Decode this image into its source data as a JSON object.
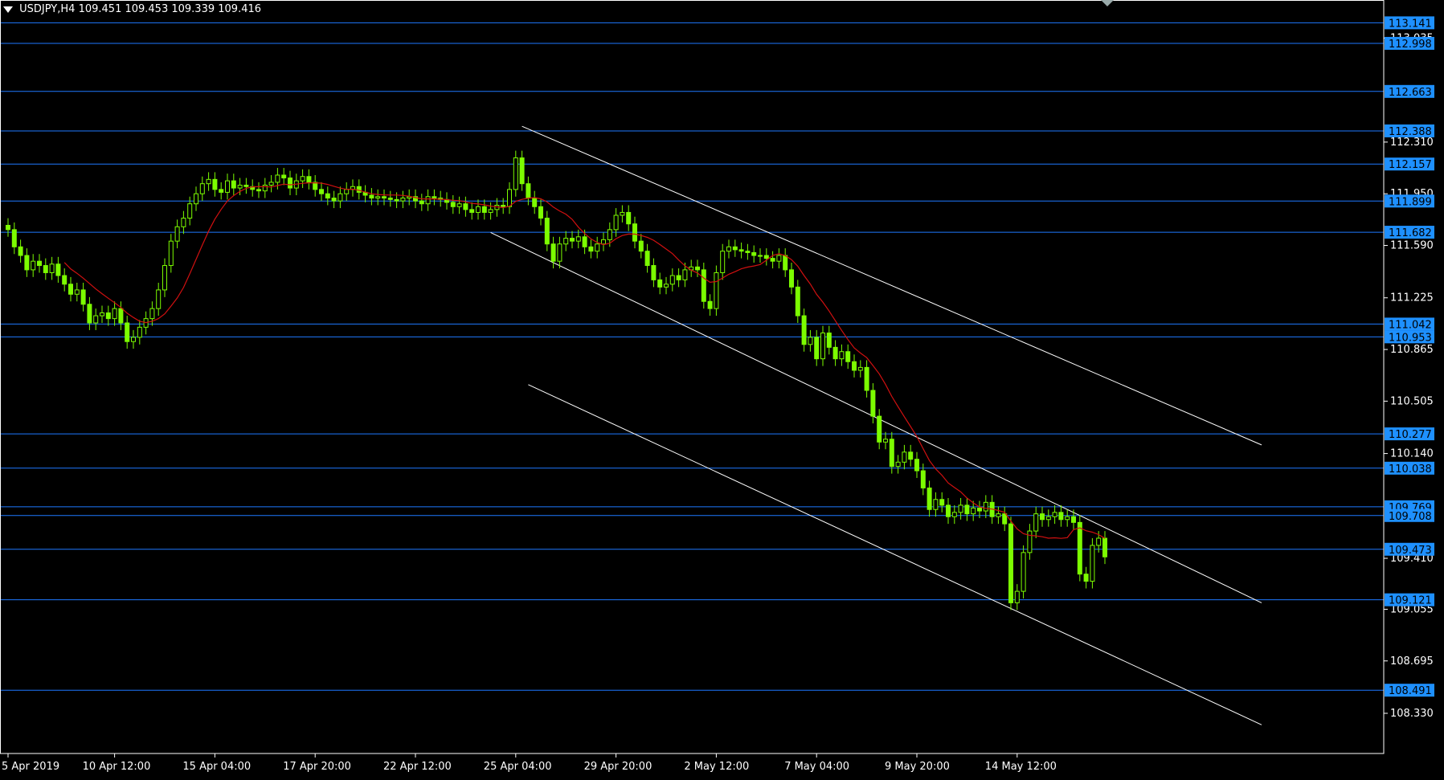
{
  "header": {
    "symbol": "USDJPY,H4",
    "ohlc": "109.451 109.453 109.339 109.416"
  },
  "colors": {
    "background": "#000000",
    "bull_candle": "#7CFC00",
    "level_line": "#1E78FF",
    "channel_line": "#FFFFFF",
    "moving_average": "#D01010",
    "axis_text": "#FFFFFF",
    "highlight_label": "#1E90FF"
  },
  "chart_data": {
    "type": "candlestick",
    "symbol": "USDJPY",
    "timeframe": "H4",
    "ylim": [
      108.05,
      113.3
    ],
    "x_ticks": [
      "5 Apr 2019",
      "10 Apr 12:00",
      "15 Apr 04:00",
      "17 Apr 20:00",
      "22 Apr 12:00",
      "25 Apr 04:00",
      "29 Apr 20:00",
      "2 May 12:00",
      "7 May 04:00",
      "9 May 20:00",
      "14 May 12:00"
    ],
    "y_ticks": [
      "113.035",
      "112.310",
      "111.950",
      "111.590",
      "111.225",
      "110.865",
      "110.505",
      "110.140",
      "109.410",
      "109.055",
      "108.695",
      "108.330"
    ],
    "level_labels": [
      "113.141",
      "112.998",
      "112.663",
      "112.388",
      "112.157",
      "111.899",
      "111.682",
      "111.042",
      "110.953",
      "110.277",
      "110.038",
      "109.769",
      "109.708",
      "109.473",
      "109.121",
      "108.491"
    ],
    "closes": [
      111.7,
      111.58,
      111.52,
      111.42,
      111.48,
      111.45,
      111.4,
      111.46,
      111.38,
      111.32,
      111.25,
      111.28,
      111.18,
      111.05,
      111.1,
      111.12,
      111.08,
      111.15,
      111.05,
      110.92,
      110.95,
      111.02,
      111.08,
      111.15,
      111.28,
      111.45,
      111.62,
      111.72,
      111.78,
      111.88,
      111.95,
      112.02,
      112.05,
      111.98,
      111.96,
      112.04,
      111.99,
      112.01,
      112.0,
      111.98,
      111.97,
      112.01,
      112.03,
      112.08,
      112.06,
      111.99,
      112.04,
      112.07,
      112.03,
      111.98,
      111.95,
      111.92,
      111.9,
      111.95,
      111.98,
      112.0,
      111.96,
      111.94,
      111.92,
      111.93,
      111.92,
      111.91,
      111.9,
      111.92,
      111.93,
      111.9,
      111.88,
      111.93,
      111.92,
      111.91,
      111.89,
      111.86,
      111.88,
      111.84,
      111.82,
      111.86,
      111.82,
      111.84,
      111.87,
      111.86,
      111.98,
      112.2,
      112.02,
      111.92,
      111.86,
      111.78,
      111.6,
      111.48,
      111.6,
      111.64,
      111.62,
      111.65,
      111.58,
      111.55,
      111.6,
      111.63,
      111.7,
      111.8,
      111.82,
      111.74,
      111.62,
      111.55,
      111.45,
      111.35,
      111.3,
      111.32,
      111.38,
      111.35,
      111.42,
      111.44,
      111.42,
      111.2,
      111.15,
      111.4,
      111.55,
      111.58,
      111.56,
      111.55,
      111.54,
      111.52,
      111.52,
      111.5,
      111.48,
      111.52,
      111.42,
      111.3,
      111.1,
      110.9,
      110.95,
      110.8,
      110.98,
      110.88,
      110.8,
      110.85,
      110.78,
      110.72,
      110.74,
      110.58,
      110.4,
      110.22,
      110.24,
      110.05,
      110.08,
      110.15,
      110.1,
      110.02,
      109.9,
      109.75,
      109.82,
      109.78,
      109.7,
      109.73,
      109.78,
      109.72,
      109.76,
      109.74,
      109.8,
      109.7,
      109.72,
      109.65,
      109.1,
      109.18,
      109.45,
      109.6,
      109.72,
      109.68,
      109.7,
      109.73,
      109.68,
      109.7,
      109.66,
      109.3,
      109.25,
      109.5,
      109.55,
      109.42
    ]
  },
  "ui": {
    "nav_marker": "▼"
  }
}
